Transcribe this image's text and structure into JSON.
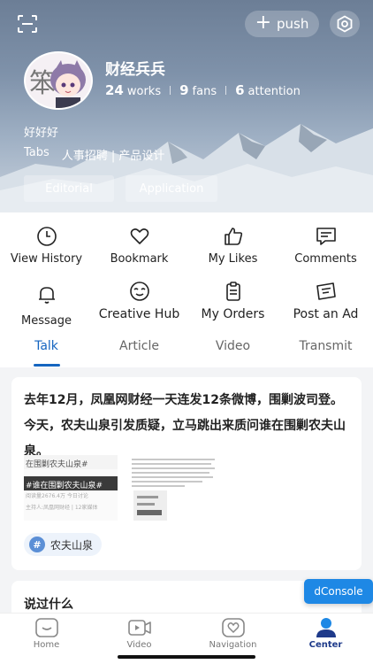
{
  "header": {
    "push_label": "push",
    "username": "财经兵兵",
    "stats": [
      {
        "value": "24",
        "label": "works"
      },
      {
        "value": "9",
        "label": "fans"
      },
      {
        "value": "6",
        "label": "attention"
      }
    ],
    "bio": "好好好",
    "tags_label": "Tabs",
    "tags_value": "人事招聘 | 产品设计",
    "chips": [
      "Editorial",
      "Application"
    ],
    "icons": {
      "scan": "scan-icon",
      "settings": "settings-icon"
    }
  },
  "grid": [
    {
      "label": "View History",
      "icon": "clock-icon"
    },
    {
      "label": "Bookmark",
      "icon": "heart-icon"
    },
    {
      "label": "My Likes",
      "icon": "thumbs-up-icon"
    },
    {
      "label": "Comments",
      "icon": "comment-icon"
    },
    {
      "label": "Message",
      "icon": "bell-icon"
    },
    {
      "label": "Creative Hub",
      "icon": "smile-icon"
    },
    {
      "label": "My Orders",
      "icon": "clipboard-icon"
    },
    {
      "label": "Post an Ad",
      "icon": "ad-icon"
    }
  ],
  "tabs": [
    {
      "label": "Talk",
      "active": true
    },
    {
      "label": "Article",
      "active": false
    },
    {
      "label": "Video",
      "active": false
    },
    {
      "label": "Transmit",
      "active": false
    }
  ],
  "post": {
    "text": "去年12月，凤凰网财经一天连发12条微博，围剿波司登。今天，农夫山泉引发质疑，立马跳出来质问谁在围剿农夫山泉。",
    "thumb1_top": "在围剿农夫山泉#",
    "thumb1_bar": "#谁在围剿农夫山泉#",
    "thumb1_meta": "阅读量2676.4万  今日讨论",
    "thumb1_meta2": "主持人:凤凰网财经 | 12家媒体",
    "hashtag": "农夫山泉"
  },
  "card2": {
    "title": "说过什么"
  },
  "dconsole": "dConsole",
  "bottom_nav": [
    {
      "label": "Home",
      "icon": "home-icon",
      "active": false
    },
    {
      "label": "Video",
      "icon": "video-icon",
      "active": false
    },
    {
      "label": "Navigation",
      "icon": "navigation-heart-icon",
      "active": false
    },
    {
      "label": "Center",
      "icon": "user-icon",
      "active": true
    }
  ],
  "colors": {
    "accent": "#1565c0",
    "dconsole": "#1e88e5",
    "nav_active": "#1e3a8a"
  }
}
